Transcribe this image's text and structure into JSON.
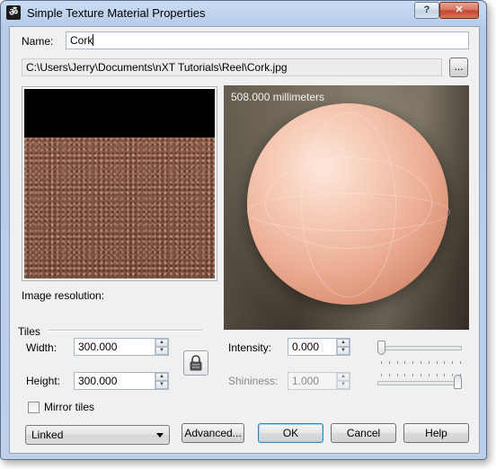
{
  "window": {
    "title": "Simple Texture Material Properties",
    "help_label": "?",
    "close_label": "✕"
  },
  "name_field": {
    "label": "Name:",
    "value": "Cork"
  },
  "path": {
    "value": "C:\\Users\\Jerry\\Documents\\nXT Tutorials\\Reel\\Cork.jpg",
    "browse_label": "..."
  },
  "preview": {
    "render_label": "508.000 millimeters"
  },
  "image_resolution_label": "Image resolution:",
  "tiles": {
    "group_label": "Tiles",
    "width_label": "Width:",
    "width_value": "300.000",
    "height_label": "Height:",
    "height_value": "300.000",
    "mirror_label": "Mirror tiles",
    "mirror_checked": false
  },
  "intensity": {
    "label": "Intensity:",
    "value": "0.000",
    "slider_fraction": 0.0
  },
  "shininess": {
    "label": "Shininess:",
    "value": "1.000",
    "slider_fraction": 1.0
  },
  "link_mode": {
    "selected": "Linked"
  },
  "buttons": {
    "advanced": "Advanced...",
    "ok": "OK",
    "cancel": "Cancel",
    "help": "Help"
  }
}
